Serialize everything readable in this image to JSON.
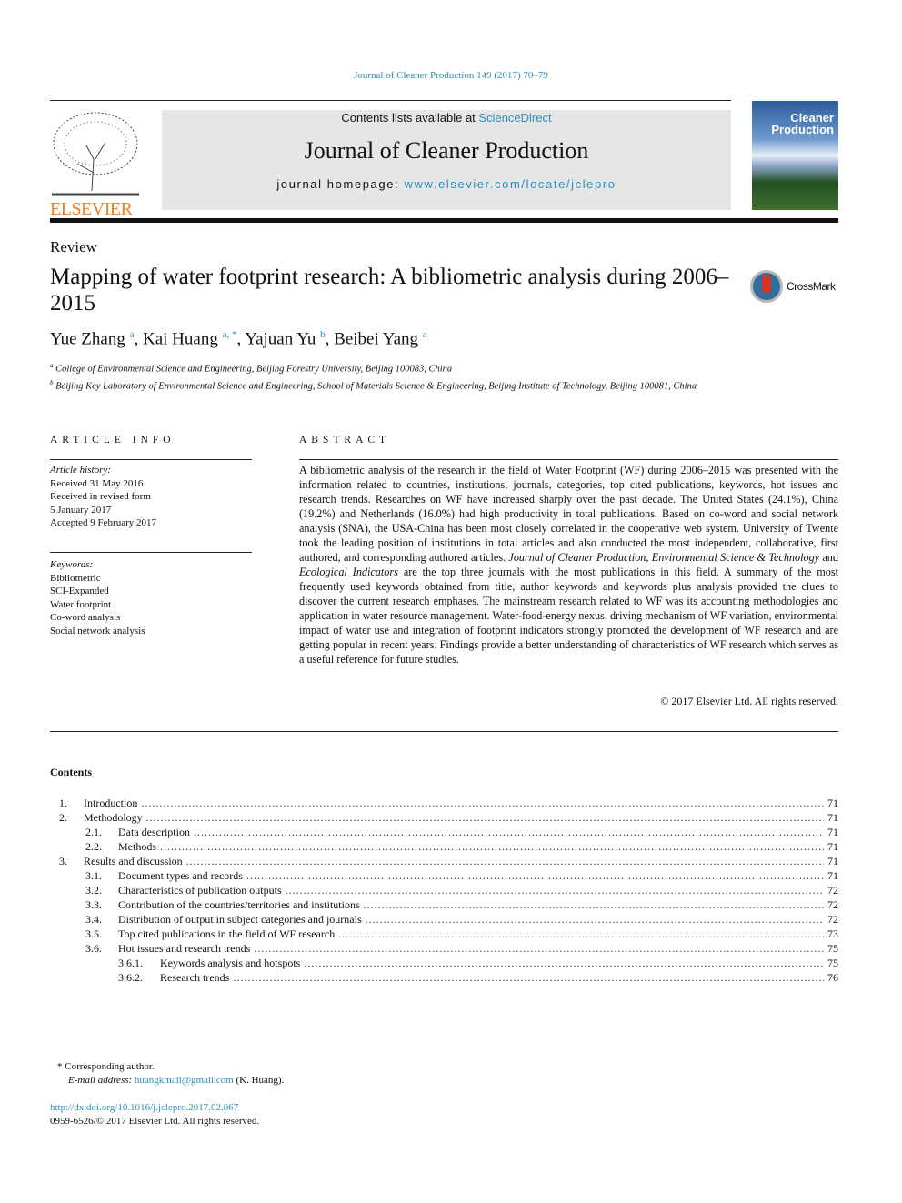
{
  "journal_ref": "Journal of Cleaner Production 149 (2017) 70–79",
  "banner": {
    "contents_prefix": "Contents lists available at ",
    "contents_link": "ScienceDirect",
    "journal_title": "Journal of Cleaner Production",
    "homepage_prefix": "journal homepage: ",
    "homepage_link": "www.elsevier.com/locate/jclepro"
  },
  "publisher_logo": "ELSEVIER",
  "cover": {
    "line1": "Cleaner",
    "line2": "Production"
  },
  "article_type": "Review",
  "title": "Mapping of water footprint research: A bibliometric analysis during 2006–2015",
  "crossmark": "CrossMark",
  "authors": [
    {
      "name": "Yue Zhang",
      "sup": "a"
    },
    {
      "name": "Kai Huang",
      "sup": "a, *"
    },
    {
      "name": "Yajuan Yu",
      "sup": "b"
    },
    {
      "name": "Beibei Yang",
      "sup": "a"
    }
  ],
  "affiliations": [
    {
      "sup": "a",
      "text": "College of Environmental Science and Engineering, Beijing Forestry University, Beijing 100083, China"
    },
    {
      "sup": "b",
      "text": "Beijing Key Laboratory of Environmental Science and Engineering, School of Materials Science & Engineering, Beijing Institute of Technology, Beijing 100081, China"
    }
  ],
  "article_info": {
    "heading": "ARTICLE INFO",
    "history_label": "Article history:",
    "history": [
      "Received 31 May 2016",
      "Received in revised form",
      "5 January 2017",
      "Accepted 9 February 2017"
    ],
    "keywords_label": "Keywords:",
    "keywords": [
      "Bibliometric",
      "SCI-Expanded",
      "Water footprint",
      "Co-word analysis",
      "Social network analysis"
    ]
  },
  "abstract": {
    "heading": "ABSTRACT",
    "p1": "A bibliometric analysis of the research in the field of Water Footprint (WF) during 2006–2015 was presented with the information related to countries, institutions, journals, categories, top cited publications, keywords, hot issues and research trends. Researches on WF have increased sharply over the past decade. The United States (24.1%), China (19.2%) and Netherlands (16.0%) had high productivity in total publications. Based on co-word and social network analysis (SNA), the USA-China has been most closely correlated in the cooperative web system. University of Twente took the leading position of institutions in total articles and also conducted the most independent, collaborative, first authored, and corresponding authored articles. ",
    "j1": "Journal of Cleaner Production",
    "sep1": ", ",
    "j2": "Environmental Science & Technology",
    "sep2": " and ",
    "j3": "Ecological Indicators",
    "p2": " are the top three journals with the most publications in this field. A summary of the most frequently used keywords obtained from title, author keywords and keywords plus analysis provided the clues to discover the current research emphases. The mainstream research related to WF was its accounting methodologies and application in water resource management. Water-food-energy nexus, driving mechanism of WF variation, environmental impact of water use and integration of footprint indicators strongly promoted the development of WF research and are getting popular in recent years. Findings provide a better understanding of characteristics of WF research which serves as a useful reference for future studies.",
    "copyright": "© 2017 Elsevier Ltd. All rights reserved."
  },
  "contents": {
    "heading": "Contents",
    "items": [
      {
        "num": "1.",
        "title": "Introduction",
        "page": "71",
        "level": 0
      },
      {
        "num": "2.",
        "title": "Methodology",
        "page": "71",
        "level": 0
      },
      {
        "num": "2.1.",
        "title": "Data description",
        "page": "71",
        "level": 1
      },
      {
        "num": "2.2.",
        "title": "Methods",
        "page": "71",
        "level": 1
      },
      {
        "num": "3.",
        "title": "Results and discussion",
        "page": "71",
        "level": 0
      },
      {
        "num": "3.1.",
        "title": "Document types and records",
        "page": "71",
        "level": 1
      },
      {
        "num": "3.2.",
        "title": "Characteristics of publication outputs",
        "page": "72",
        "level": 1
      },
      {
        "num": "3.3.",
        "title": "Contribution of the countries/territories and institutions",
        "page": "72",
        "level": 1
      },
      {
        "num": "3.4.",
        "title": "Distribution of output in subject categories and journals",
        "page": "72",
        "level": 1
      },
      {
        "num": "3.5.",
        "title": "Top cited publications in the field of WF research",
        "page": "73",
        "level": 1
      },
      {
        "num": "3.6.",
        "title": "Hot issues and research trends",
        "page": "75",
        "level": 1
      },
      {
        "num": "3.6.1.",
        "title": "Keywords analysis and hotspots",
        "page": "75",
        "level": 2
      },
      {
        "num": "3.6.2.",
        "title": "Research trends",
        "page": "76",
        "level": 2
      }
    ]
  },
  "footnote": {
    "mark": "*",
    "corresponding": "Corresponding author.",
    "email_label": "E-mail address: ",
    "email": "huangkmail@gmail.com",
    "email_suffix": " (K. Huang)."
  },
  "doi": "http://dx.doi.org/10.1016/j.jclepro.2017.02.067",
  "issn_line": "0959-6526/© 2017 Elsevier Ltd. All rights reserved."
}
